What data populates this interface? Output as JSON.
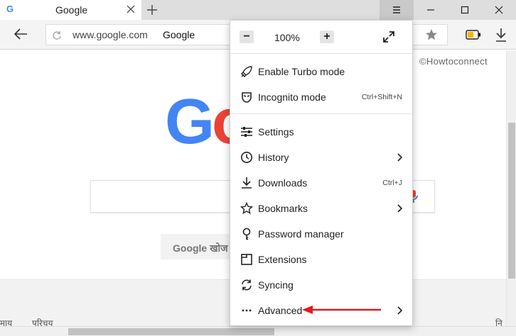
{
  "tab": {
    "title": "Google",
    "favicon": "G"
  },
  "address_bar": {
    "domain": "www.google.com",
    "page_title": "Google"
  },
  "page": {
    "logo_letters": [
      "G",
      "o"
    ],
    "search_button": "Google खोज",
    "footer_left": [
      "माय",
      "परिचय"
    ],
    "footer_right": "नि",
    "watermark": "©Howtoconnect"
  },
  "menu": {
    "zoom": {
      "minus": "−",
      "level": "100%",
      "plus": "+"
    },
    "items": [
      {
        "label": "Enable Turbo mode",
        "icon": "turbo-icon"
      },
      {
        "label": "Incognito mode",
        "icon": "incognito-icon",
        "shortcut": "Ctrl+Shift+N"
      },
      {
        "label": "Settings",
        "icon": "settings-icon"
      },
      {
        "label": "History",
        "icon": "history-icon",
        "submenu": true
      },
      {
        "label": "Downloads",
        "icon": "download-icon",
        "shortcut": "Ctrl+J"
      },
      {
        "label": "Bookmarks",
        "icon": "bookmark-star-icon",
        "submenu": true
      },
      {
        "label": "Password manager",
        "icon": "key-icon"
      },
      {
        "label": "Extensions",
        "icon": "extensions-icon"
      },
      {
        "label": "Syncing",
        "icon": "sync-icon"
      },
      {
        "label": "Advanced",
        "icon": "more-dots-icon",
        "submenu": true
      }
    ]
  },
  "colors": {
    "google_blue": "#4285f4",
    "google_red": "#ea4335",
    "annotation_arrow": "#e11b1b",
    "titlebar": "#dedede"
  }
}
